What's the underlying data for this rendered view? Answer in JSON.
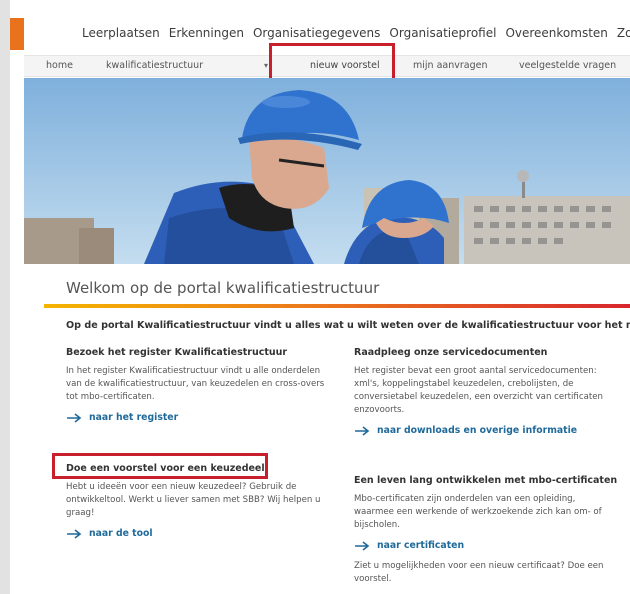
{
  "topnav": {
    "home_icon": "home-icon",
    "items": [
      "Leerplaatsen",
      "Erkenningen",
      "Organisatiegegevens",
      "Organisatieprofiel",
      "Overeenkomsten",
      "Zoeken"
    ]
  },
  "subnav": {
    "home": "home",
    "kwalificatie": "kwalificatiestructuur",
    "caret_icon": "caret-down-icon",
    "nieuw": "nieuw voorstel",
    "aanvragen": "mijn aanvragen",
    "vragen": "veelgestelde vragen"
  },
  "hero": {
    "image": "two construction workers in blue hard hats in front of buildings"
  },
  "main": {
    "title": "Welkom op de portal kwalificatiestructuur",
    "intro": "Op de portal Kwalificatiestructuur vindt u alles wat u wilt weten over de kwalificatiestructuur voor het mbo.",
    "sections": {
      "register": {
        "heading": "Bezoek het register Kwalificatiestructuur",
        "lines": [
          "In het register Kwalificatiestructuur vindt u alle onderdelen",
          "van de kwalificatiestructuur, van keuzedelen en cross-overs",
          "tot mbo-certificaten."
        ],
        "link": "naar het register"
      },
      "service": {
        "heading": "Raadpleeg onze servicedocumenten",
        "lines": [
          "Het register bevat een groot aantal servicedocumenten:",
          "xml's, koppelingstabel keuzedelen, crebolijsten, de",
          "conversietabel keuzedelen, een overzicht van certificaten",
          "enzovoorts."
        ],
        "link": "naar downloads en overige informatie"
      },
      "voorstel": {
        "heading": "Doe een voorstel voor een keuzedeel",
        "lines": [
          "Hebt u ideeën voor een nieuw keuzedeel? Gebruik de",
          "ontwikkeltool. Werkt u liever samen met SBB? Wij helpen u",
          "graag!"
        ],
        "link": "naar de tool"
      },
      "certificaten": {
        "heading": "Een leven lang ontwikkelen met mbo-certificaten",
        "lines": [
          "Mbo-certificaten zijn onderdelen van een opleiding,",
          "waarmee een werkende of werkzoekende zich kan om- of",
          "bijscholen."
        ],
        "link": "naar certificaten",
        "extra_lines": [
          "Ziet u mogelijkheden voor een nieuw certificaat? Doe een",
          "voorstel."
        ]
      }
    }
  },
  "colors": {
    "orange": "#e8731c",
    "highlight": "#c7202c",
    "link": "#1f6a9a",
    "sky": "#9fc4e3",
    "helmet": "#2f73cf"
  }
}
